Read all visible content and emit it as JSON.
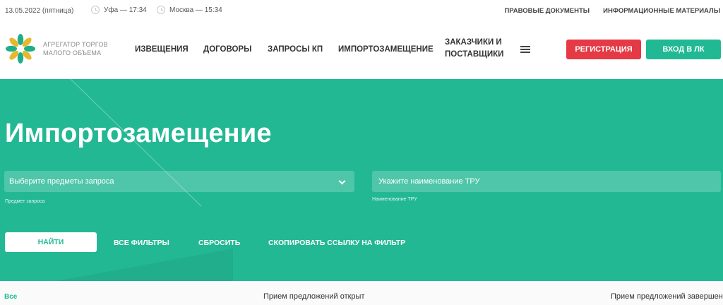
{
  "topbar": {
    "date": "13.05.2022 (пятница)",
    "clock_ufa": "Уфа — 17:34",
    "clock_moscow": "Москва — 15:34",
    "link_legal": "ПРАВОВЫЕ ДОКУМЕНТЫ",
    "link_info": "ИНФОРМАЦИОННЫЕ МАТЕРИАЛЫ"
  },
  "header": {
    "logo_text_line1": "АГРЕГАТОР ТОРГОВ",
    "logo_text_line2": "МАЛОГО ОБЪЕМА",
    "nav": {
      "notices": "ИЗВЕЩЕНИЯ",
      "contracts": "ДОГОВОРЫ",
      "requests": "ЗАПРОСЫ КП",
      "import_sub": "ИМПОРТОЗАМЕЩЕНИЕ",
      "customers": "ЗАКАЗЧИКИ И ПОСТАВЩИКИ"
    },
    "register_label": "РЕГИСТРАЦИЯ",
    "login_label": "ВХОД В ЛК"
  },
  "hero": {
    "title": "Импортозамещение",
    "subject_placeholder": "Выберите предметы запроса",
    "subject_hint": "Предмет запроса",
    "tru_placeholder": "Укажите наименование ТРУ",
    "tru_hint": "Наименование ТРУ",
    "find_label": "НАЙТИ",
    "all_filters_label": "ВСЕ ФИЛЬТРЫ",
    "reset_label": "СБРОСИТЬ",
    "copy_link_label": "СКОПИРОВАТЬ ССЫЛКУ НА ФИЛЬТР"
  },
  "status": {
    "all": "Все",
    "open": "Прием предложений открыт",
    "done": "Прием предложений завершен"
  },
  "colors": {
    "brand_green": "#23b894",
    "button_green": "#21b993",
    "register_red": "#e53945",
    "logo_gold": "#e8b730"
  },
  "icons": {
    "logo": "petal-star-logo",
    "clock": "clock-icon",
    "burger": "menu-icon",
    "chevron": "chevron-down-icon"
  }
}
